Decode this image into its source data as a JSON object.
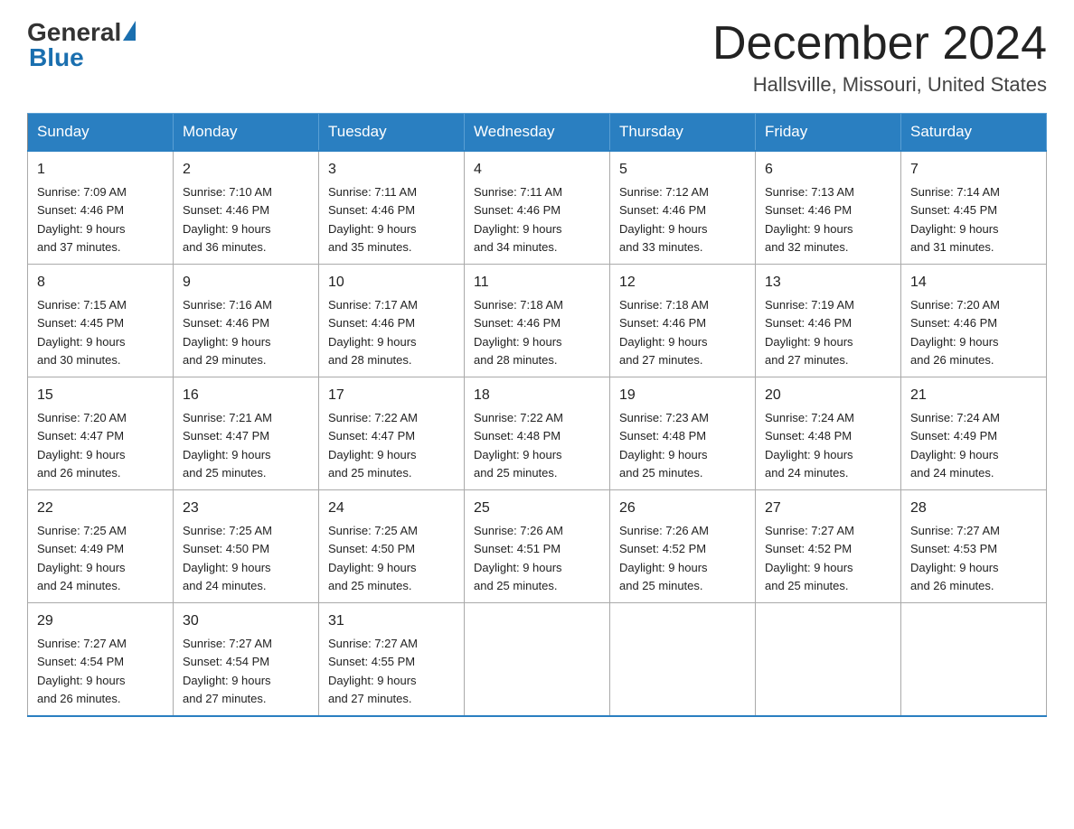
{
  "header": {
    "logo_general": "General",
    "logo_blue": "Blue",
    "title": "December 2024",
    "subtitle": "Hallsville, Missouri, United States"
  },
  "weekdays": [
    "Sunday",
    "Monday",
    "Tuesday",
    "Wednesday",
    "Thursday",
    "Friday",
    "Saturday"
  ],
  "weeks": [
    [
      {
        "day": "1",
        "sunrise": "7:09 AM",
        "sunset": "4:46 PM",
        "daylight": "9 hours and 37 minutes."
      },
      {
        "day": "2",
        "sunrise": "7:10 AM",
        "sunset": "4:46 PM",
        "daylight": "9 hours and 36 minutes."
      },
      {
        "day": "3",
        "sunrise": "7:11 AM",
        "sunset": "4:46 PM",
        "daylight": "9 hours and 35 minutes."
      },
      {
        "day": "4",
        "sunrise": "7:11 AM",
        "sunset": "4:46 PM",
        "daylight": "9 hours and 34 minutes."
      },
      {
        "day": "5",
        "sunrise": "7:12 AM",
        "sunset": "4:46 PM",
        "daylight": "9 hours and 33 minutes."
      },
      {
        "day": "6",
        "sunrise": "7:13 AM",
        "sunset": "4:46 PM",
        "daylight": "9 hours and 32 minutes."
      },
      {
        "day": "7",
        "sunrise": "7:14 AM",
        "sunset": "4:45 PM",
        "daylight": "9 hours and 31 minutes."
      }
    ],
    [
      {
        "day": "8",
        "sunrise": "7:15 AM",
        "sunset": "4:45 PM",
        "daylight": "9 hours and 30 minutes."
      },
      {
        "day": "9",
        "sunrise": "7:16 AM",
        "sunset": "4:46 PM",
        "daylight": "9 hours and 29 minutes."
      },
      {
        "day": "10",
        "sunrise": "7:17 AM",
        "sunset": "4:46 PM",
        "daylight": "9 hours and 28 minutes."
      },
      {
        "day": "11",
        "sunrise": "7:18 AM",
        "sunset": "4:46 PM",
        "daylight": "9 hours and 28 minutes."
      },
      {
        "day": "12",
        "sunrise": "7:18 AM",
        "sunset": "4:46 PM",
        "daylight": "9 hours and 27 minutes."
      },
      {
        "day": "13",
        "sunrise": "7:19 AM",
        "sunset": "4:46 PM",
        "daylight": "9 hours and 27 minutes."
      },
      {
        "day": "14",
        "sunrise": "7:20 AM",
        "sunset": "4:46 PM",
        "daylight": "9 hours and 26 minutes."
      }
    ],
    [
      {
        "day": "15",
        "sunrise": "7:20 AM",
        "sunset": "4:47 PM",
        "daylight": "9 hours and 26 minutes."
      },
      {
        "day": "16",
        "sunrise": "7:21 AM",
        "sunset": "4:47 PM",
        "daylight": "9 hours and 25 minutes."
      },
      {
        "day": "17",
        "sunrise": "7:22 AM",
        "sunset": "4:47 PM",
        "daylight": "9 hours and 25 minutes."
      },
      {
        "day": "18",
        "sunrise": "7:22 AM",
        "sunset": "4:48 PM",
        "daylight": "9 hours and 25 minutes."
      },
      {
        "day": "19",
        "sunrise": "7:23 AM",
        "sunset": "4:48 PM",
        "daylight": "9 hours and 25 minutes."
      },
      {
        "day": "20",
        "sunrise": "7:24 AM",
        "sunset": "4:48 PM",
        "daylight": "9 hours and 24 minutes."
      },
      {
        "day": "21",
        "sunrise": "7:24 AM",
        "sunset": "4:49 PM",
        "daylight": "9 hours and 24 minutes."
      }
    ],
    [
      {
        "day": "22",
        "sunrise": "7:25 AM",
        "sunset": "4:49 PM",
        "daylight": "9 hours and 24 minutes."
      },
      {
        "day": "23",
        "sunrise": "7:25 AM",
        "sunset": "4:50 PM",
        "daylight": "9 hours and 24 minutes."
      },
      {
        "day": "24",
        "sunrise": "7:25 AM",
        "sunset": "4:50 PM",
        "daylight": "9 hours and 25 minutes."
      },
      {
        "day": "25",
        "sunrise": "7:26 AM",
        "sunset": "4:51 PM",
        "daylight": "9 hours and 25 minutes."
      },
      {
        "day": "26",
        "sunrise": "7:26 AM",
        "sunset": "4:52 PM",
        "daylight": "9 hours and 25 minutes."
      },
      {
        "day": "27",
        "sunrise": "7:27 AM",
        "sunset": "4:52 PM",
        "daylight": "9 hours and 25 minutes."
      },
      {
        "day": "28",
        "sunrise": "7:27 AM",
        "sunset": "4:53 PM",
        "daylight": "9 hours and 26 minutes."
      }
    ],
    [
      {
        "day": "29",
        "sunrise": "7:27 AM",
        "sunset": "4:54 PM",
        "daylight": "9 hours and 26 minutes."
      },
      {
        "day": "30",
        "sunrise": "7:27 AM",
        "sunset": "4:54 PM",
        "daylight": "9 hours and 27 minutes."
      },
      {
        "day": "31",
        "sunrise": "7:27 AM",
        "sunset": "4:55 PM",
        "daylight": "9 hours and 27 minutes."
      },
      null,
      null,
      null,
      null
    ]
  ],
  "labels": {
    "sunrise": "Sunrise: ",
    "sunset": "Sunset: ",
    "daylight": "Daylight: "
  }
}
